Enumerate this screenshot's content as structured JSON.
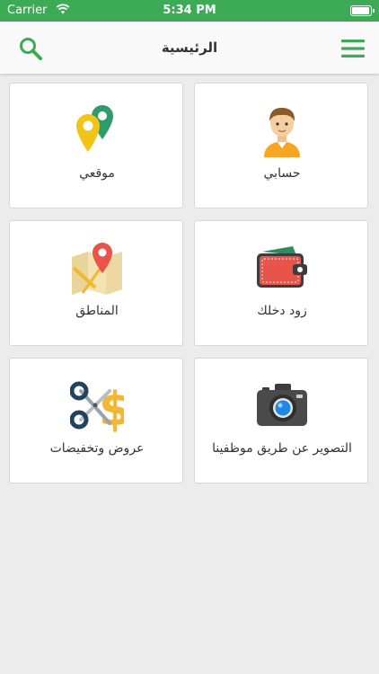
{
  "status_bar": {
    "carrier": "Carrier",
    "time": "5:34 PM"
  },
  "nav": {
    "title": "الرئيسية",
    "search_icon": "search-icon",
    "menu_icon": "menu-icon"
  },
  "accent_color": "#3daa56",
  "tiles": [
    {
      "label": "حسابي",
      "icon": "user-avatar-icon"
    },
    {
      "label": "موقعي",
      "icon": "location-pins-icon"
    },
    {
      "label": "زود دخلك",
      "icon": "wallet-icon"
    },
    {
      "label": "المناطق",
      "icon": "map-icon"
    },
    {
      "label": "التصوير عن طريق موظفينا",
      "icon": "camera-icon"
    },
    {
      "label": "عروض وتخفيضات",
      "icon": "scissors-dollar-icon"
    }
  ]
}
